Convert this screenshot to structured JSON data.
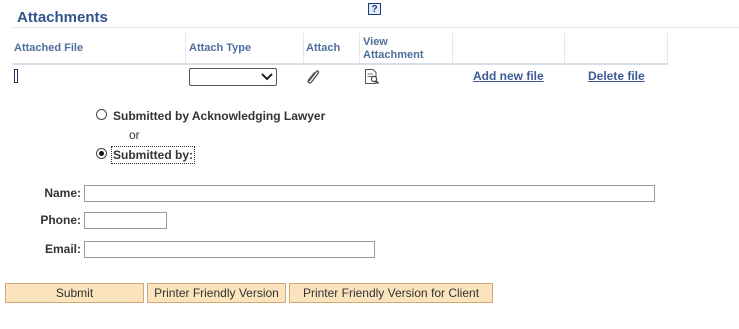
{
  "header": {
    "title": "Attachments",
    "help_icon_glyph": "?"
  },
  "grid": {
    "columns": [
      "Attached File",
      "Attach Type",
      "Attach",
      "View Attachment"
    ],
    "row": {
      "attach_type_value": "",
      "add_link": "Add new file",
      "delete_link": "Delete file"
    }
  },
  "submitter": {
    "option1": "Submitted by Acknowledging Lawyer",
    "or_text": "or",
    "option2": "Submitted by:",
    "selected": "option2"
  },
  "form": {
    "name_label": "Name:",
    "name_value": "",
    "phone_label": "Phone:",
    "phone_value": "",
    "email_label": "Email:",
    "email_value": ""
  },
  "buttons": {
    "submit": "Submit",
    "printer": "Printer Friendly Version",
    "printer_client": "Printer Friendly Version for Client"
  },
  "icons": {
    "help": "help-icon",
    "attach": "paperclip-icon",
    "view": "view-document-icon"
  },
  "colors": {
    "title": "#31548c",
    "header_text": "#4e6f9e",
    "link": "#3c5a94",
    "button_bg": "#fbe3bd",
    "button_border": "#d3a878"
  }
}
